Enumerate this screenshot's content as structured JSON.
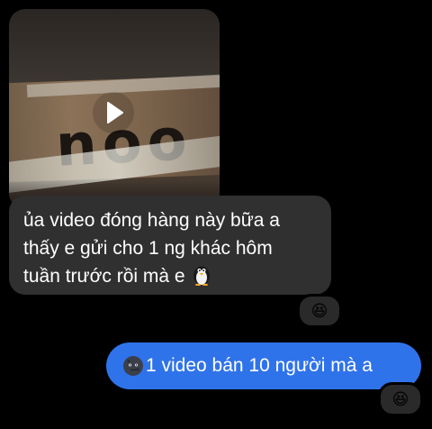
{
  "conversation": {
    "incoming": {
      "video": {
        "box_logo": "noo",
        "play_icon": "play-icon"
      },
      "message_lines": [
        "ủa video đóng hàng này bữa a",
        "thấy e gửi cho 1 ng khác hôm",
        "tuần trước rồi mà e"
      ],
      "trailing_emoji": "penguin",
      "reaction": "😆"
    },
    "outgoing": {
      "leading_emoji": "new-moon-face",
      "message": "1 video bán 10 người mà a",
      "reaction": "😆"
    }
  },
  "colors": {
    "background": "#000000",
    "incoming_bubble": "#303030",
    "outgoing_bubble": "#2f73ea",
    "text": "#ffffff"
  }
}
